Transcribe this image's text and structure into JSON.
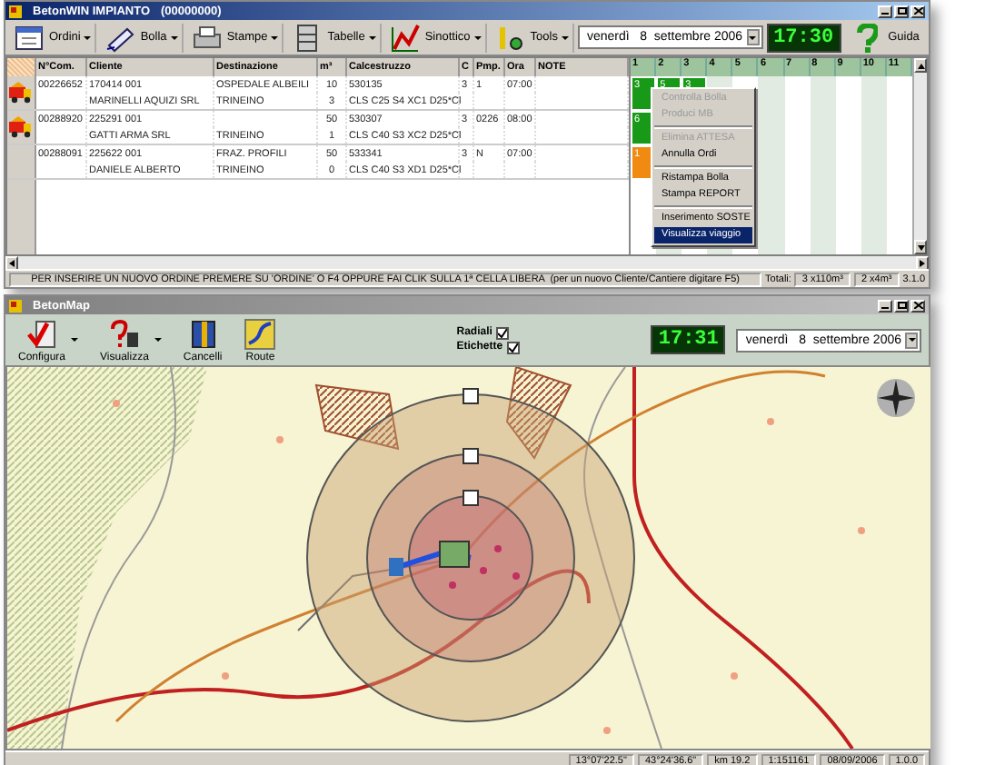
{
  "main_window": {
    "title": "BetonWIN IMPIANTO",
    "code": "(00000000)",
    "toolbar": [
      {
        "label": "Ordini",
        "menu": true
      },
      {
        "label": "Bolla",
        "menu": true
      },
      {
        "label": "Stampe",
        "menu": true
      },
      {
        "label": "Tabelle",
        "menu": true
      },
      {
        "label": "Sinottico",
        "menu": true
      },
      {
        "label": "Tools",
        "menu": true
      }
    ],
    "date": "venerdì   8  settembre 2006",
    "clock": "17:30",
    "help": "Guida",
    "table": {
      "columns": [
        "N°Com.",
        "Cliente",
        "Destinazione",
        "m³",
        "Calcestruzzo",
        "C",
        "Pmp.",
        "Ora",
        "NOTE"
      ],
      "rows": [
        {
          "truck": true,
          "number": "00226652",
          "client_code": "170414 001",
          "client": "MARINELLI  AQUIZI SRL",
          "destination": "OSPEDALE ALBEILI",
          "destination_2": "TRINEINO",
          "m3": "10",
          "m3_2": "3",
          "mix_code": "530135",
          "mix": "CLS C25 S4 XC1 D25*Cl",
          "c": "3",
          "pump": "1",
          "time": "07:00"
        },
        {
          "truck": true,
          "number": "00288920",
          "client_code": "225291 001",
          "client": "GATTI ARMA  SRL",
          "destination_2": "TRINEINO",
          "m3": "50",
          "m3_2": "1",
          "mix_code": "530307",
          "mix": "CLS C40 S3 XC2 D25*Cl",
          "c": "3",
          "pump": "0226",
          "time": "08:00"
        },
        {
          "truck": false,
          "number": "00288091",
          "client_code": "225622 001",
          "client": "DANIELE ALBERTO",
          "destination": "FRAZ. PROFILI",
          "destination_2": "TRINEINO",
          "m3": "50",
          "m3_2": "0",
          "mix_code": "533341",
          "mix": "CLS C40 S3 XD1 D25*Cl",
          "c": "3",
          "pump": "N",
          "time": "07:00"
        }
      ]
    },
    "schedule": {
      "columns": [
        "1",
        "2",
        "3",
        "4",
        "5",
        "6",
        "7",
        "8",
        "9",
        "10",
        "11"
      ],
      "rows": [
        [
          {
            "label": "3",
            "color": "#189a18"
          },
          {
            "label": "5",
            "color": "#189a18"
          },
          {
            "label": "3",
            "color": "#189a18"
          }
        ],
        [
          {
            "label": "6",
            "color": "#189a18"
          }
        ],
        [
          {
            "label": "1",
            "color": "#f08a10"
          }
        ]
      ]
    },
    "context_menu": [
      [
        {
          "label": "Controlla Bolla",
          "disabled": true,
          "selected": false
        },
        {
          "label": "Produci MB",
          "disabled": true,
          "selected": false
        }
      ],
      [
        {
          "label": "Elimina ATTESA",
          "disabled": true,
          "selected": false
        },
        {
          "label": "Annulla Ordi",
          "disabled": false,
          "selected": false
        }
      ],
      [
        {
          "label": "Ristampa Bolla",
          "disabled": false,
          "selected": false
        },
        {
          "label": "Stampa REPORT",
          "disabled": false,
          "selected": false
        }
      ],
      [
        {
          "label": "Inserimento SOSTE",
          "disabled": false,
          "selected": false
        },
        {
          "label": "Visualizza viaggio",
          "disabled": false,
          "selected": true
        }
      ]
    ],
    "status_bar": {
      "message": "PER INSERIRE UN NUOVO ORDINE PREMERE SU 'ORDINE' O F4 OPPURE FAI CLIK SULLA 1ª CELLA LIBERA  (per un nuovo Cliente/Cantiere digitare F5)",
      "totals_label": "Totali:",
      "totals": [
        "3 x110m³",
        "2 x4m³"
      ],
      "version": "3.1.0"
    }
  },
  "map_window": {
    "title": "BetonMap",
    "toolbar": [
      {
        "label": "Configura",
        "menu": true
      },
      {
        "label": "Visualizza",
        "menu": true
      },
      {
        "label": "Cancelli",
        "menu": false
      },
      {
        "label": "Route",
        "menu": false
      }
    ],
    "options": [
      {
        "label": "Radiali",
        "checked": true
      },
      {
        "label": "Etichette",
        "checked": true
      }
    ],
    "clock": "17:31",
    "date": "venerdì   8  settembre 2006",
    "status_bar": [
      "13°07'22.5\"",
      "43°24'36.6\"",
      "km 19.2",
      "1:151161",
      "08/09/2006",
      "1.0.0"
    ]
  }
}
